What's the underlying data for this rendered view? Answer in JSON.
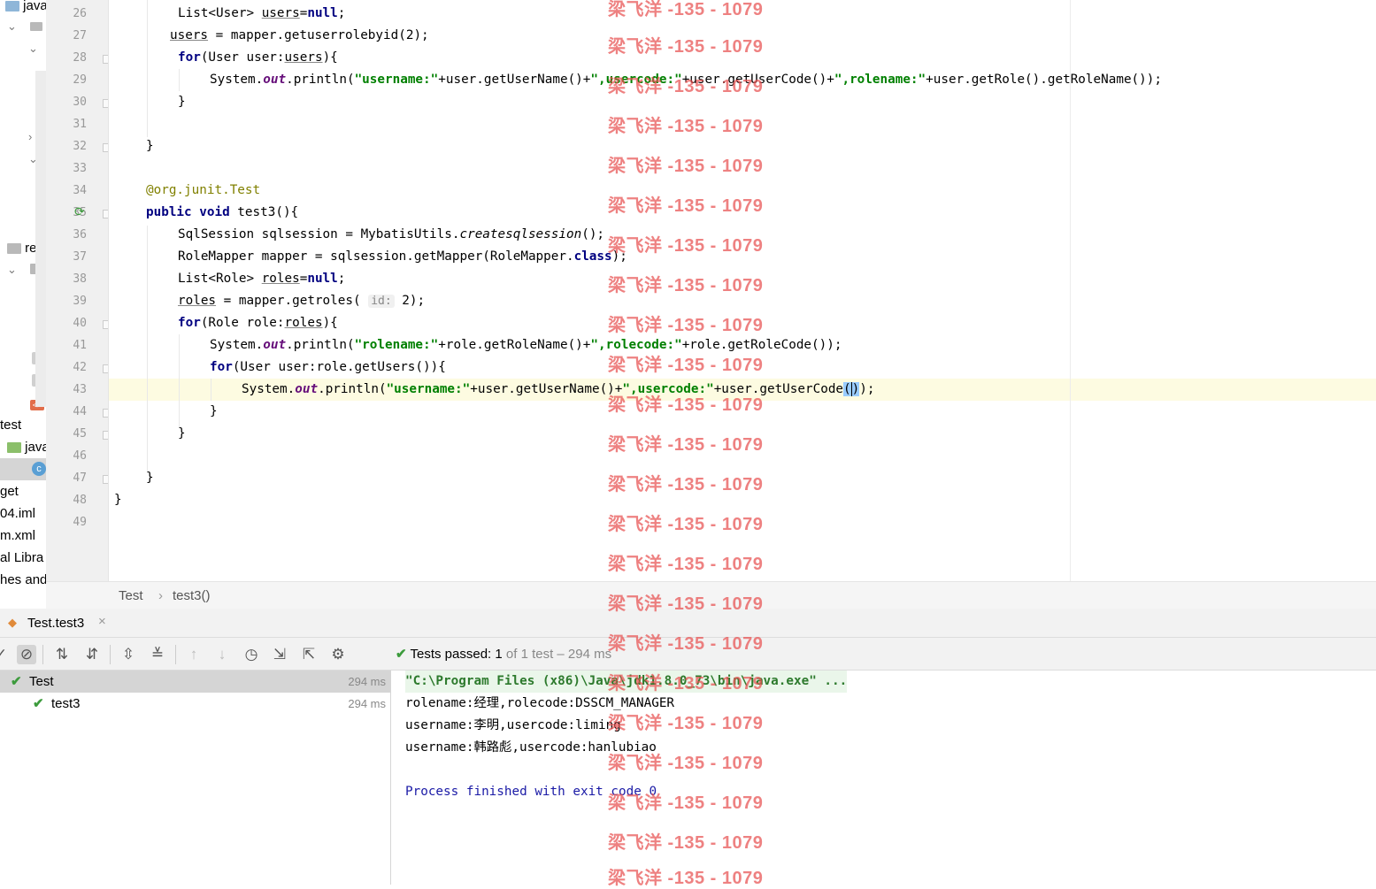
{
  "project_tree": {
    "items": [
      "java",
      "res",
      "test",
      "java",
      "get",
      "04.iml",
      "m.xml",
      "al Libra",
      "hes and"
    ]
  },
  "editor": {
    "line_numbers": [
      "26",
      "27",
      "28",
      "29",
      "30",
      "31",
      "32",
      "33",
      "34",
      "35",
      "36",
      "37",
      "38",
      "39",
      "40",
      "41",
      "42",
      "43",
      "44",
      "45",
      "46",
      "47",
      "48",
      "49"
    ],
    "lines": {
      "l26": [
        "List<User> ",
        "users",
        "=",
        "null",
        ";"
      ],
      "l27": [
        "users",
        " = mapper.getuserrolebyid(2);"
      ],
      "l28": [
        "for",
        "(User user:",
        "users",
        "){"
      ],
      "l29": [
        "System.",
        "out",
        ".println(",
        "\"username:\"",
        "+user.getUserName()+",
        "\",usercode:\"",
        "+user.getUserCode()+",
        "\",rolename:\"",
        "+user.getRole().getRoleName());"
      ],
      "l30": "}",
      "l32": "}",
      "l34": [
        "@org.junit.",
        "Test"
      ],
      "l35": [
        "public void",
        " test3(){"
      ],
      "l36": [
        "SqlSession sqlsession = MybatisUtils.",
        "createsqlsession",
        "();"
      ],
      "l37": [
        "RoleMapper mapper = sqlsession.getMapper(RoleMapper.",
        "class",
        ");"
      ],
      "l38": [
        "List<Role> ",
        "roles",
        "=",
        "null",
        ";"
      ],
      "l39": [
        "roles",
        " = mapper.getroles( ",
        "id:",
        " 2);"
      ],
      "l40": [
        "for",
        "(Role role:",
        "roles",
        "){"
      ],
      "l41": [
        "System.",
        "out",
        ".println(",
        "\"rolename:\"",
        "+role.getRoleName()+",
        "\",rolecode:\"",
        "+role.getRoleCode());"
      ],
      "l42": [
        "for",
        "(User user:role.getUsers()){"
      ],
      "l43": [
        "System.",
        "out",
        ".println(",
        "\"username:\"",
        "+user.getUserName()+",
        "\",usercode:\"",
        "+user.getUserCode",
        "(",
        ")",
        ");"
      ],
      "l44": "}",
      "l45": "}",
      "l47": "}",
      "l48": "}"
    }
  },
  "breadcrumb": [
    "Test",
    "test3()"
  ],
  "run_tab": {
    "label": "Test.test3"
  },
  "toolbar": {
    "status_passed": "Tests passed:",
    "status_count": "1",
    "status_rest": "of 1 test – 294 ms"
  },
  "tests_tree": [
    {
      "name": "Test",
      "time": "294 ms"
    },
    {
      "name": "test3",
      "time": "294 ms"
    }
  ],
  "console": {
    "lines": [
      "\"C:\\Program Files (x86)\\Java\\jdk1.8.0_73\\bin\\java.exe\" ...",
      "rolename:经理,rolecode:DSSCM_MANAGER",
      "username:李明,usercode:liming",
      "username:韩路彪,usercode:hanlubiao",
      "",
      "Process finished with exit code 0"
    ]
  },
  "watermark": {
    "text": "梁飞洋 -135 - 1079"
  },
  "colors": {
    "keyword": "#000080",
    "string": "#008000",
    "current_line": "#fdfbe1",
    "watermark": "#e85050",
    "pass": "#3c9b3c"
  }
}
